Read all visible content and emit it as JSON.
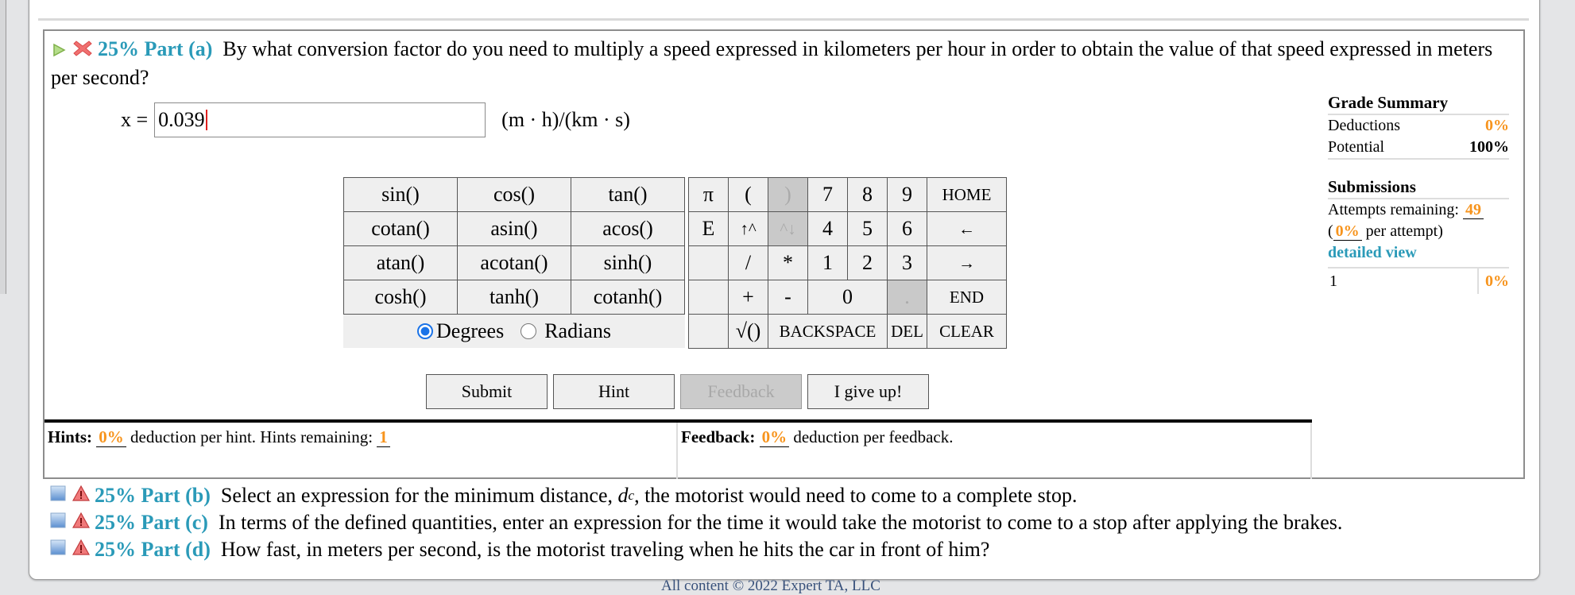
{
  "part_a": {
    "weight": "25%",
    "label": "Part (a)",
    "question": "By what conversion factor do you need to multiply a speed expressed in kilometers per hour in order to obtain the value of that speed expressed in meters per second?",
    "variable": "x =",
    "answer_value": "0.039",
    "units": "(m · h)/(km · s)"
  },
  "functions": {
    "rows": [
      [
        "sin()",
        "cos()",
        "tan()"
      ],
      [
        "cotan()",
        "asin()",
        "acos()"
      ],
      [
        "atan()",
        "acotan()",
        "sinh()"
      ],
      [
        "cosh()",
        "tanh()",
        "cotanh()"
      ]
    ],
    "angle_mode": {
      "degrees": "Degrees",
      "radians": "Radians",
      "selected": "Degrees"
    }
  },
  "keypad": {
    "pi": "π",
    "e": "E",
    "open_paren": "(",
    "close_paren": ")",
    "up_caret": "↑^",
    "caret_down": "^↓",
    "divide": "/",
    "multiply": "*",
    "plus": "+",
    "minus": "-",
    "sqrt": "√()",
    "dot": ".",
    "d7": "7",
    "d8": "8",
    "d9": "9",
    "d4": "4",
    "d5": "5",
    "d6": "6",
    "d1": "1",
    "d2": "2",
    "d3": "3",
    "d0": "0",
    "home": "HOME",
    "left": "←",
    "right": "→",
    "end": "END",
    "backspace": "BACKSPACE",
    "del": "DEL",
    "clear": "CLEAR"
  },
  "buttons": {
    "submit": "Submit",
    "hint": "Hint",
    "feedback": "Feedback",
    "give_up": "I give up!"
  },
  "hints": {
    "label": "Hints:",
    "deduction": "0%",
    "text": "deduction per hint. Hints remaining:",
    "remaining": "1"
  },
  "feedback": {
    "label": "Feedback:",
    "deduction": "0%",
    "text": "deduction per feedback."
  },
  "grade_summary": {
    "title": "Grade Summary",
    "deductions_label": "Deductions",
    "deductions_value": "0%",
    "potential_label": "Potential",
    "potential_value": "100%",
    "submissions_title": "Submissions",
    "attempts_label": "Attempts remaining:",
    "attempts_value": "49",
    "per_attempt_value": "0%",
    "per_attempt_text": "per attempt)",
    "detailed_view": "detailed view",
    "submission_rows": [
      {
        "number": "1",
        "score": "0%"
      }
    ]
  },
  "other_parts": [
    {
      "weight": "25%",
      "label": "Part (b)",
      "question_pre": "Select an expression for the minimum distance,",
      "var": "d",
      "sub": "c",
      "question_post": ", the motorist would need to come to a complete stop."
    },
    {
      "weight": "25%",
      "label": "Part (c)",
      "question_pre": "In terms of the defined quantities, enter an expression for the time it would take the motorist to come to a stop after applying the brakes."
    },
    {
      "weight": "25%",
      "label": "Part (d)",
      "question_pre": "How fast, in meters per second, is the motorist traveling when he hits the car in front of him?"
    }
  ],
  "footer": "All content © 2022 Expert TA, LLC",
  "colors": {
    "accent": "#2a9ab8",
    "orange": "#f7941d",
    "caret": "#e0201e"
  }
}
